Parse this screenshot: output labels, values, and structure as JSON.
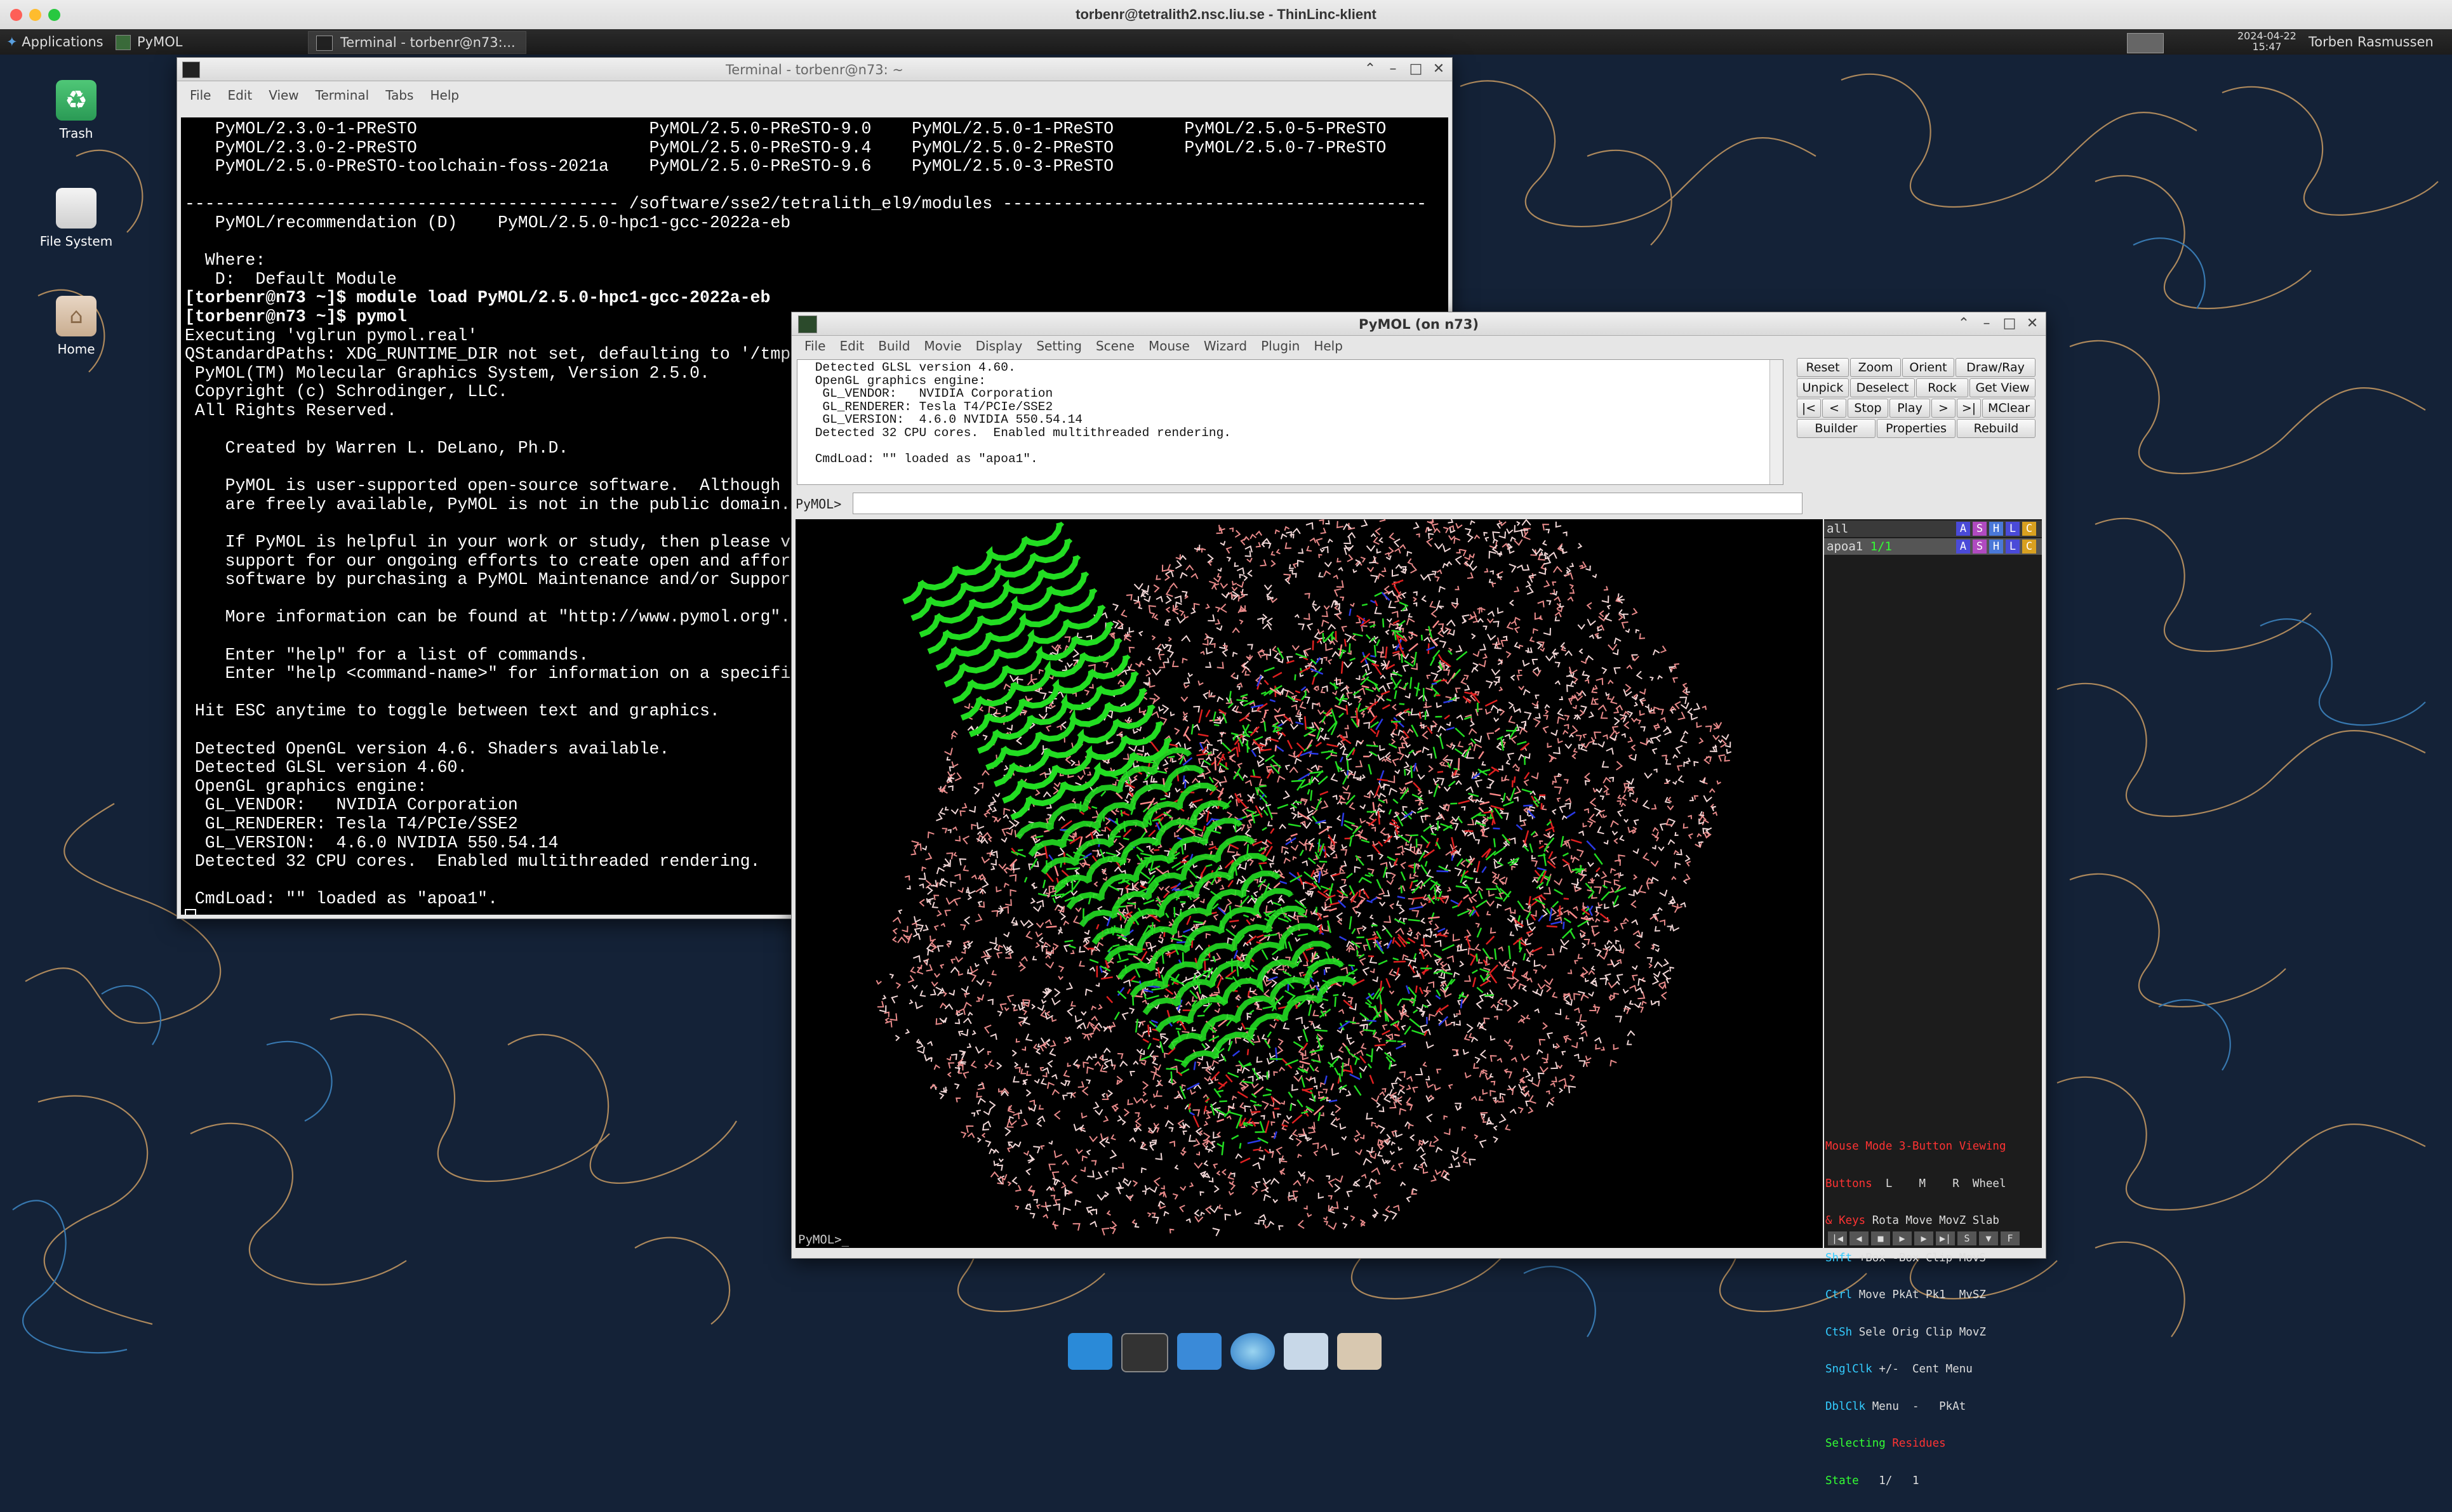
{
  "host_window": {
    "title": "torbenr@tetralith2.nsc.liu.se - ThinLinc-klient"
  },
  "panel": {
    "applications_label": "Applications",
    "pymol_task": "PyMOL",
    "terminal_task": "Terminal - torbenr@n73:...",
    "date": "2024-04-22",
    "time": "15:47",
    "user": "Torben Rasmussen"
  },
  "desktop_icons": [
    {
      "label": "Trash",
      "icon": "trash-icon"
    },
    {
      "label": "File System",
      "icon": "drive-icon"
    },
    {
      "label": "Home",
      "icon": "home-folder-icon"
    }
  ],
  "terminal": {
    "title": "Terminal - torbenr@n73: ~",
    "menu": [
      "File",
      "Edit",
      "View",
      "Terminal",
      "Tabs",
      "Help"
    ],
    "lines": [
      "   PyMOL/2.3.0-1-PReSTO                       PyMOL/2.5.0-PReSTO-9.0    PyMOL/2.5.0-1-PReSTO       PyMOL/2.5.0-5-PReSTO",
      "   PyMOL/2.3.0-2-PReSTO                       PyMOL/2.5.0-PReSTO-9.4    PyMOL/2.5.0-2-PReSTO       PyMOL/2.5.0-7-PReSTO",
      "   PyMOL/2.5.0-PReSTO-toolchain-foss-2021a    PyMOL/2.5.0-PReSTO-9.6    PyMOL/2.5.0-3-PReSTO",
      "",
      "------------------------------------------- /software/sse2/tetralith_el9/modules ------------------------------------------",
      "   PyMOL/recommendation (D)    PyMOL/2.5.0-hpc1-gcc-2022a-eb",
      "",
      "  Where:",
      "   D:  Default Module",
      "[torbenr@n73 ~]$ module load PyMOL/2.5.0-hpc1-gcc-2022a-eb",
      "[torbenr@n73 ~]$ pymol",
      "Executing 'vglrun pymol.real'",
      "QStandardPaths: XDG_RUNTIME_DIR not set, defaulting to '/tmp/r",
      " PyMOL(TM) Molecular Graphics System, Version 2.5.0.",
      " Copyright (c) Schrodinger, LLC.",
      " All Rights Reserved.",
      "",
      "    Created by Warren L. DeLano, Ph.D.",
      "",
      "    PyMOL is user-supported open-source software.  Although so",
      "    are freely available, PyMOL is not in the public domain.",
      "",
      "    If PyMOL is helpful in your work or study, then please vol",
      "    support for our ongoing efforts to create open and afforda",
      "    software by purchasing a PyMOL Maintenance and/or Support",
      "",
      "    More information can be found at \"http://www.pymol.org\".",
      "",
      "    Enter \"help\" for a list of commands.",
      "    Enter \"help <command-name>\" for information on a specific",
      "",
      " Hit ESC anytime to toggle between text and graphics.",
      "",
      " Detected OpenGL version 4.6. Shaders available.",
      " Detected GLSL version 4.60.",
      " OpenGL graphics engine:",
      "  GL_VENDOR:   NVIDIA Corporation",
      "  GL_RENDERER: Tesla T4/PCIe/SSE2",
      "  GL_VERSION:  4.6.0 NVIDIA 550.54.14",
      " Detected 32 CPU cores.  Enabled multithreaded rendering.",
      "",
      " CmdLoad: \"\" loaded as \"apoa1\"."
    ]
  },
  "pymol": {
    "title": "PyMOL (on n73)",
    "menu": [
      "File",
      "Edit",
      "Build",
      "Movie",
      "Display",
      "Setting",
      "Scene",
      "Mouse",
      "Wizard",
      "Plugin",
      "Help"
    ],
    "output_lines": [
      " Detected GLSL version 4.60.",
      " OpenGL graphics engine:",
      "  GL_VENDOR:   NVIDIA Corporation",
      "  GL_RENDERER: Tesla T4/PCIe/SSE2",
      "  GL_VERSION:  4.6.0 NVIDIA 550.54.14",
      " Detected 32 CPU cores.  Enabled multithreaded rendering.",
      "",
      " CmdLoad: \"\" loaded as \"apoa1\"."
    ],
    "cmd_label": "PyMOL>",
    "cmd_value": "",
    "viewport_prompt": "PyMOL>_",
    "buttons": {
      "row1": [
        "Reset",
        "Zoom",
        "Orient",
        "Draw/Ray"
      ],
      "row2": [
        "Unpick",
        "Deselect",
        "Rock",
        "Get View"
      ],
      "row3": [
        "|<",
        "<",
        "Stop",
        "Play",
        ">",
        ">|",
        "MClear"
      ],
      "row4": [
        "Builder",
        "Properties",
        "Rebuild"
      ]
    },
    "objects": [
      {
        "name": "all",
        "count": ""
      },
      {
        "name": "apoa1",
        "count": "1/1"
      }
    ],
    "object_buttons": [
      "A",
      "S",
      "H",
      "L",
      "C"
    ],
    "object_button_colors": {
      "A": "#4a4ad8",
      "S": "#b04ac0",
      "H": "#4a78d8",
      "L": "#4a4ad8",
      "C": "#d8a020"
    },
    "mouse_mode": {
      "header_a": "Mouse Mode",
      "header_b": "3-Button Viewing",
      "buttons_label": "Buttons",
      "buttons_cols": "L    M    R  Wheel",
      "rows": [
        {
          "key": "& Keys",
          "vals": "Rota Move MovZ Slab"
        },
        {
          "key": "Shft",
          "vals": "+Box -Box Clip MovS"
        },
        {
          "key": "Ctrl",
          "vals": "Move PkAt Pk1  MvSZ"
        },
        {
          "key": "CtSh",
          "vals": "Sele Orig Clip MovZ"
        },
        {
          "key": "SnglClk",
          "vals": "+/-  Cent Menu"
        },
        {
          "key": "DblClk",
          "vals": "Menu  -   PkAt"
        }
      ],
      "selecting_label": "Selecting",
      "selecting_value": "Residues",
      "state_label": "State",
      "state_value": "1/   1"
    }
  },
  "colors": {
    "desktop_bg": "#142237",
    "cartoon_green": "#22dd22",
    "water_pink": "#e88a8a",
    "oxygen_red": "#e02020",
    "nitrogen_blue": "#2a3ae8"
  }
}
